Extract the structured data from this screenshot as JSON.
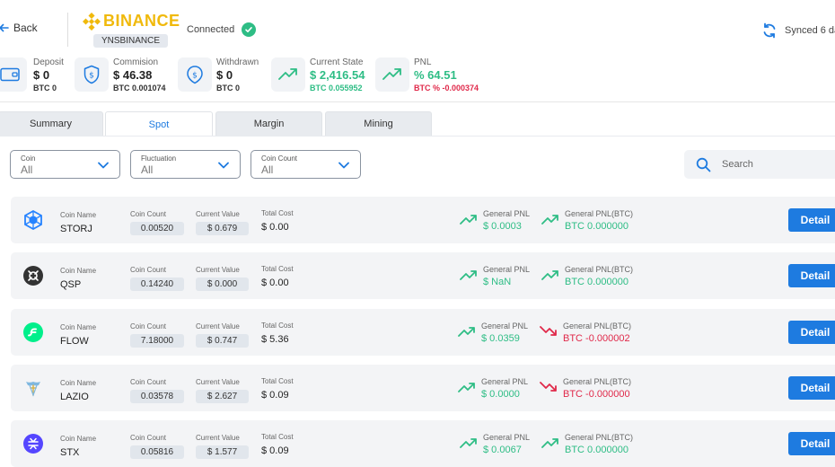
{
  "header": {
    "back_label": "Back",
    "brand": "BINANCE",
    "account": "YNSBINANCE",
    "status": "Connected",
    "synced": "Synced 6 da"
  },
  "stats": [
    {
      "label": "Deposit",
      "value": "$ 0",
      "sub": "BTC 0",
      "icon": "wallet-icon"
    },
    {
      "label": "Commision",
      "value": "$ 46.38",
      "sub": "BTC 0.001074",
      "icon": "shield-dollar-icon"
    },
    {
      "label": "Withdrawn",
      "value": "$ 0",
      "sub": "BTC 0",
      "icon": "withdraw-icon"
    },
    {
      "label": "Current State",
      "value": "$ 2,416.54",
      "sub": "BTC 0.055952",
      "icon": "trend-up-icon"
    },
    {
      "label": "PNL",
      "value": "% 64.51",
      "sub": "BTC % -0.000374",
      "icon": "trend-up-icon"
    }
  ],
  "tabs": [
    {
      "label": "Summary",
      "active": false
    },
    {
      "label": "Spot",
      "active": true
    },
    {
      "label": "Margin",
      "active": false
    },
    {
      "label": "Mining",
      "active": false
    }
  ],
  "filters": [
    {
      "label": "Coin",
      "value": "All"
    },
    {
      "label": "Fluctuation",
      "value": "All"
    },
    {
      "label": "Coin Count",
      "value": "All"
    }
  ],
  "search": {
    "placeholder": "Search"
  },
  "columns": {
    "coin_name": "Coin Name",
    "coin_count": "Coin Count",
    "current_value": "Current Value",
    "total_cost": "Total Cost",
    "general_pnl": "General PNL",
    "general_pnl_btc": "General PNL(BTC)",
    "detail": "Detail"
  },
  "rows": [
    {
      "name": "STORJ",
      "count": "0.00520",
      "value": "$ 0.679",
      "cost": "$ 0.00",
      "pnl": "$ 0.0003",
      "pnl_dir": "up",
      "pnl_btc": "BTC 0.000000",
      "pnl_btc_dir": "up",
      "icon_color": "#2683ff"
    },
    {
      "name": "QSP",
      "count": "0.14240",
      "value": "$ 0.000",
      "cost": "$ 0.00",
      "pnl": "$ NaN",
      "pnl_dir": "up",
      "pnl_btc": "BTC 0.000000",
      "pnl_btc_dir": "up",
      "icon_color": "#333333"
    },
    {
      "name": "FLOW",
      "count": "7.18000",
      "value": "$ 0.747",
      "cost": "$ 5.36",
      "pnl": "$ 0.0359",
      "pnl_dir": "up",
      "pnl_btc": "BTC -0.000002",
      "pnl_btc_dir": "down",
      "icon_color": "#00ef8b"
    },
    {
      "name": "LAZIO",
      "count": "0.03578",
      "value": "$ 2.627",
      "cost": "$ 0.09",
      "pnl": "$ 0.0000",
      "pnl_dir": "up",
      "pnl_btc": "BTC -0.000000",
      "pnl_btc_dir": "down",
      "icon_color": "#7fb8e0"
    },
    {
      "name": "STX",
      "count": "0.05816",
      "value": "$ 1.577",
      "cost": "$ 0.09",
      "pnl": "$ 0.0067",
      "pnl_dir": "up",
      "pnl_btc": "BTC 0.000000",
      "pnl_btc_dir": "up",
      "icon_color": "#5546ff"
    }
  ],
  "colors": {
    "accent": "#1e7be0",
    "positive": "#2ebd85",
    "negative": "#e0294a",
    "brand": "#f0b90b"
  }
}
